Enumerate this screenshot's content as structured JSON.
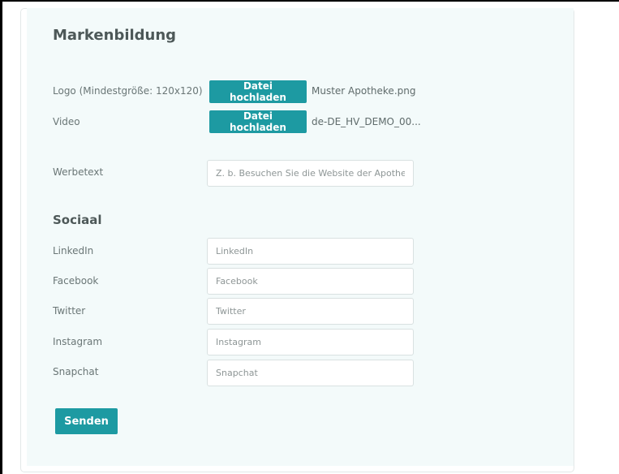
{
  "branding": {
    "title": "Markenbildung",
    "logo_label": "Logo (Mindestgröße: 120x120)",
    "logo_button": "Datei hochladen",
    "logo_file": "Muster Apotheke.png",
    "video_label": "Video",
    "video_button": "Datei hochladen",
    "video_file": "de-DE_HV_DEMO_00...",
    "ad_text_label": "Werbetext",
    "ad_text_placeholder": "Z. b. Besuchen Sie die Website der Apotheke"
  },
  "social": {
    "title": "Sociaal",
    "linkedin_label": "LinkedIn",
    "linkedin_placeholder": "LinkedIn",
    "facebook_label": "Facebook",
    "facebook_placeholder": "Facebook",
    "twitter_label": "Twitter",
    "twitter_placeholder": "Twitter",
    "instagram_label": "Instagram",
    "instagram_placeholder": "Instagram",
    "snapchat_label": "Snapchat",
    "snapchat_placeholder": "Snapchat"
  },
  "actions": {
    "send_label": "Senden"
  },
  "colors": {
    "accent": "#1d9aa2",
    "panel_background": "#f3fafa"
  }
}
